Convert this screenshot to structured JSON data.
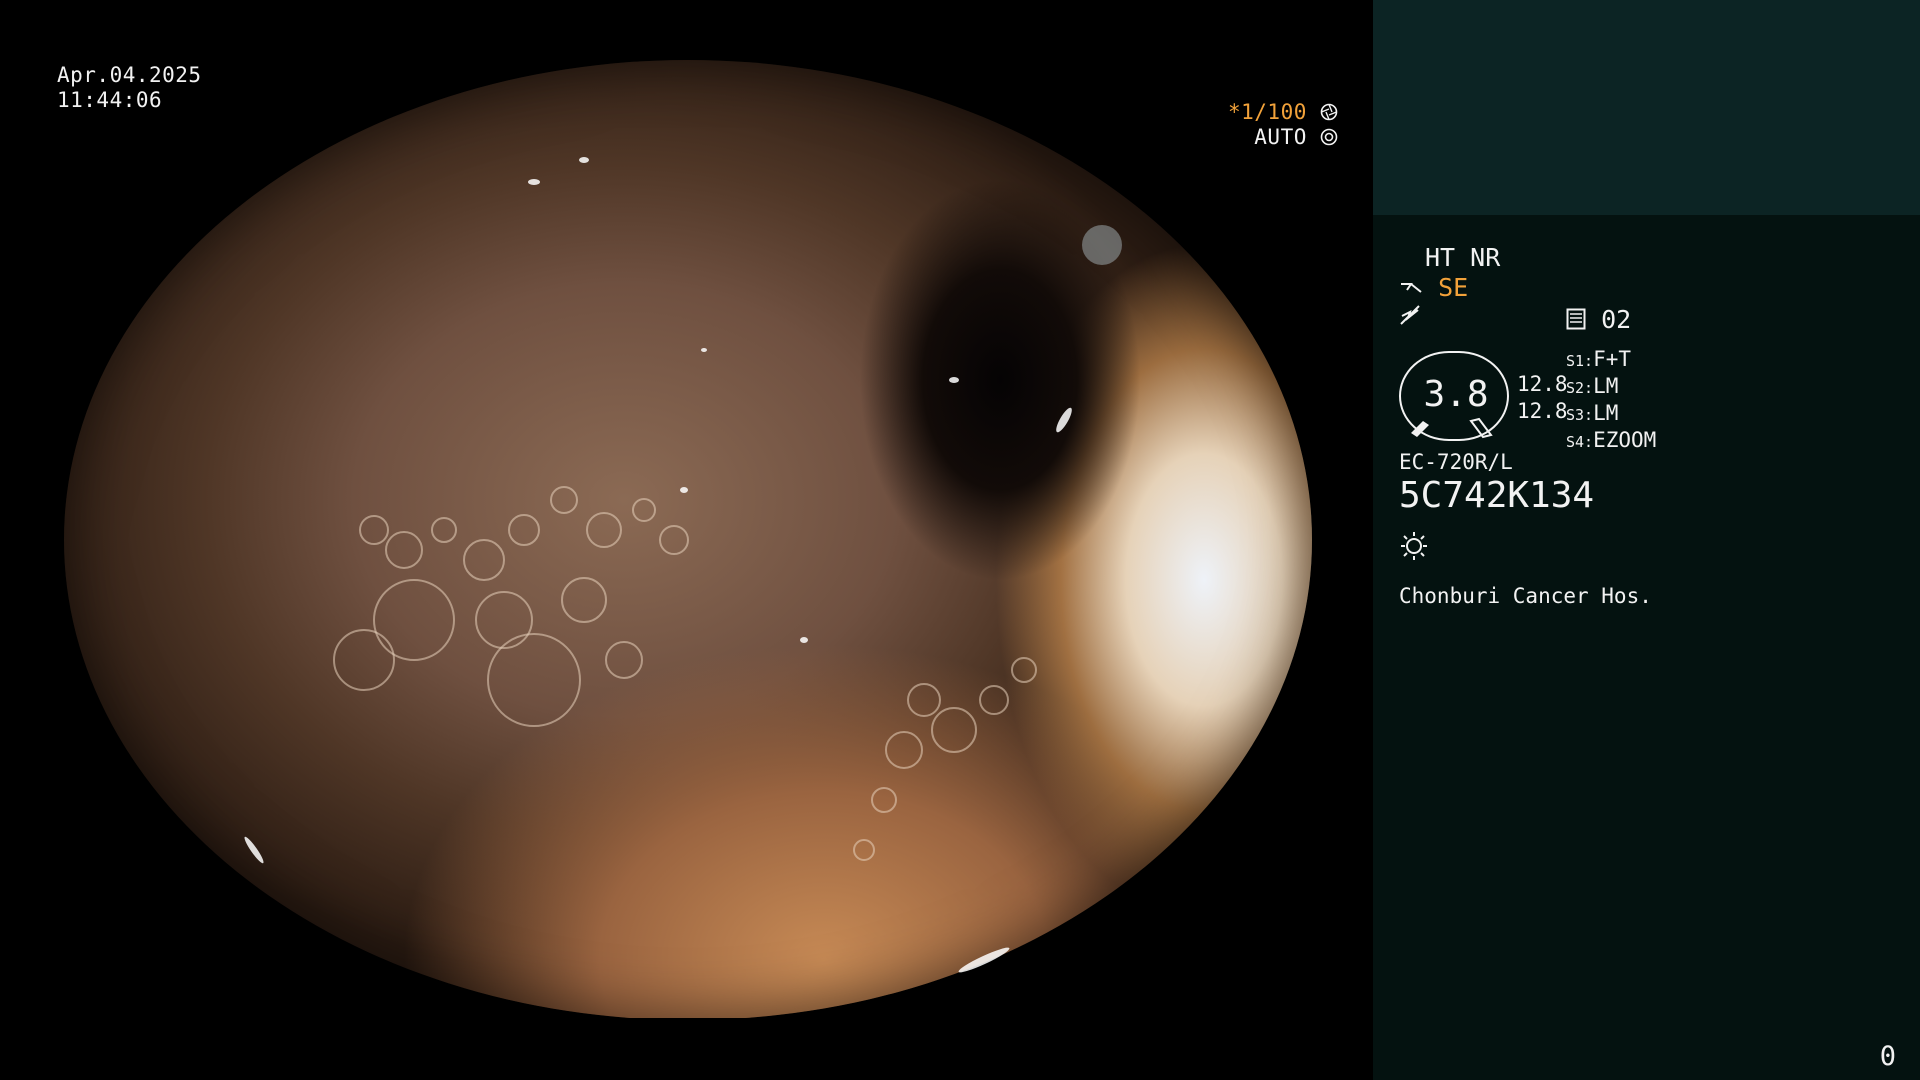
{
  "overlay": {
    "date": "Apr.04.2025",
    "time": "11:44:06",
    "shutter": "*1/100",
    "mode": "AUTO"
  },
  "panel": {
    "enhancement": "HT NR",
    "structure_mode": "SE",
    "memory_label": "02",
    "dial_value": "3.8",
    "dial_top_value": "12.8",
    "dial_bottom_value": "12.8",
    "switches": [
      {
        "key": "S1:",
        "value": "F+T"
      },
      {
        "key": "S2:",
        "value": "LM"
      },
      {
        "key": "S3:",
        "value": "LM"
      },
      {
        "key": "S4:",
        "value": "EZOOM"
      }
    ],
    "scope_model": "EC-720R/L",
    "serial": "5C742K134",
    "hospital": "Chonburi Cancer Hos.",
    "frame_index": "0"
  },
  "colors": {
    "accent": "#f2a23a",
    "panel_bg": "#041210",
    "panel_header": "#0c2424"
  },
  "icons": [
    "aperture-icon",
    "iris-icon",
    "scope-icon",
    "flash-icon",
    "memory-icon",
    "light-source-icon"
  ]
}
